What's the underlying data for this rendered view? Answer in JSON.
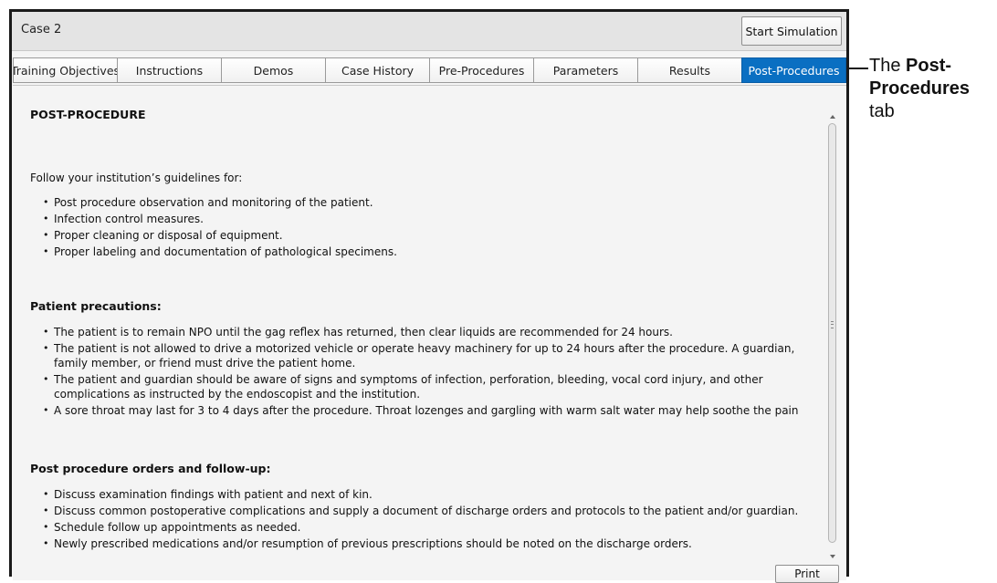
{
  "window": {
    "title": "Case 2"
  },
  "toolbar": {
    "start_label": "Start Simulation",
    "print_label": "Print"
  },
  "tabs": [
    {
      "label": "Training Objectives",
      "active": false
    },
    {
      "label": "Instructions",
      "active": false
    },
    {
      "label": "Demos",
      "active": false
    },
    {
      "label": "Case History",
      "active": false
    },
    {
      "label": "Pre-Procedures",
      "active": false
    },
    {
      "label": "Parameters",
      "active": false
    },
    {
      "label": "Results",
      "active": false
    },
    {
      "label": "Post-Procedures",
      "active": true
    }
  ],
  "content": {
    "heading": "POST-PROCEDURE",
    "intro": "Follow your institution’s guidelines for:",
    "guidelines": [
      "Post procedure observation and monitoring of the patient.",
      "Infection control measures.",
      "Proper cleaning or disposal of equipment.",
      "Proper labeling and documentation of pathological specimens."
    ],
    "precautions_heading": "Patient precautions:",
    "precautions": [
      "The patient is to remain NPO until the gag reflex has returned, then clear liquids are recommended for 24 hours.",
      "The patient is not allowed to drive a motorized vehicle or operate heavy machinery for up to 24 hours after the procedure. A guardian, family member, or friend must drive the patient home.",
      "The patient and guardian should be aware of signs and symptoms of infection, perforation, bleeding, vocal cord injury, and other complications as instructed by the endoscopist and the institution.",
      "A sore throat may last for 3 to 4 days after the procedure. Throat lozenges and gargling with warm salt water may help soothe the pain"
    ],
    "orders_heading": "Post procedure orders and follow-up:",
    "orders": [
      "Discuss examination findings with patient and next of kin.",
      "Discuss common postoperative complications and supply a document of discharge orders and protocols to the patient and/or guardian.",
      "Schedule follow up appointments as needed.",
      "Newly prescribed medications and/or resumption of previous prescriptions should be noted on the discharge orders."
    ]
  },
  "annotation": {
    "prefix": "The ",
    "bold": "Post-Procedures",
    "suffix": " tab"
  },
  "colors": {
    "active_tab": "#0a6fc2"
  }
}
